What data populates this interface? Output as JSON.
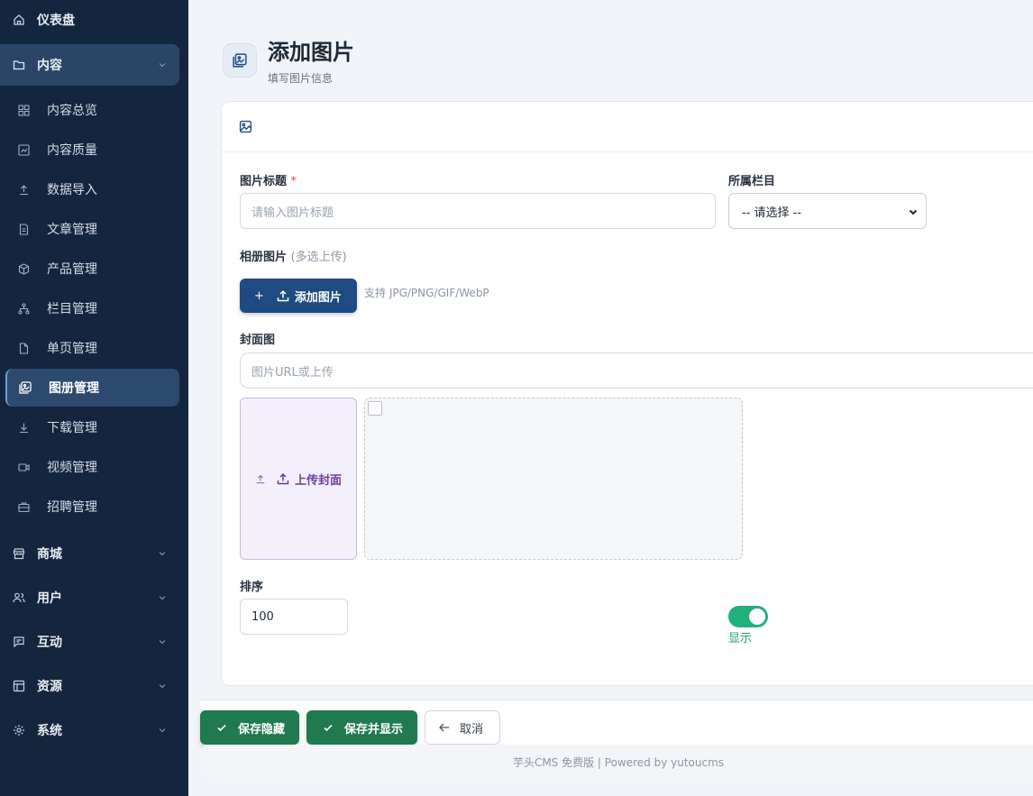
{
  "sidebar": {
    "dashboard": "仪表盘",
    "content": "内容",
    "content_items": [
      "内容总览",
      "内容质量",
      "数据导入",
      "文章管理",
      "产品管理",
      "栏目管理",
      "单页管理",
      "图册管理",
      "下载管理",
      "视频管理",
      "招聘管理"
    ],
    "shop": "商城",
    "users": "用户",
    "interact": "互动",
    "resources": "资源",
    "system": "系统"
  },
  "header": {
    "title": "添加图片",
    "subtitle": "填写图片信息"
  },
  "form": {
    "title_label": "图片标题",
    "required_mark": "*",
    "title_placeholder": "请输入图片标题",
    "category_label": "所属栏目",
    "category_selected": "-- 请选择 --",
    "album_label": "相册图片",
    "album_hint": "(多选上传)",
    "add_image_button": "添加图片",
    "add_image_plus": "+",
    "support_text": "支持 JPG/PNG/GIF/WebP",
    "cover_label": "封面图",
    "cover_placeholder": "图片URL或上传",
    "upload_cover_button": "上传封面",
    "sort_label": "排序",
    "sort_value": "100",
    "display_label": "显示",
    "display_on": true
  },
  "actions": {
    "save_hidden": "保存隐藏",
    "save_show": "保存并显示",
    "cancel": "取消"
  },
  "footer": {
    "copyright": "芋头CMS 免费版 | Powered by yutoucms"
  },
  "colors": {
    "sidebar_bg": "#14263d",
    "primary": "#1f4a82",
    "success": "#1f7a4f",
    "toggle": "#22b07d",
    "upload_purple": "#6b3fa0"
  }
}
